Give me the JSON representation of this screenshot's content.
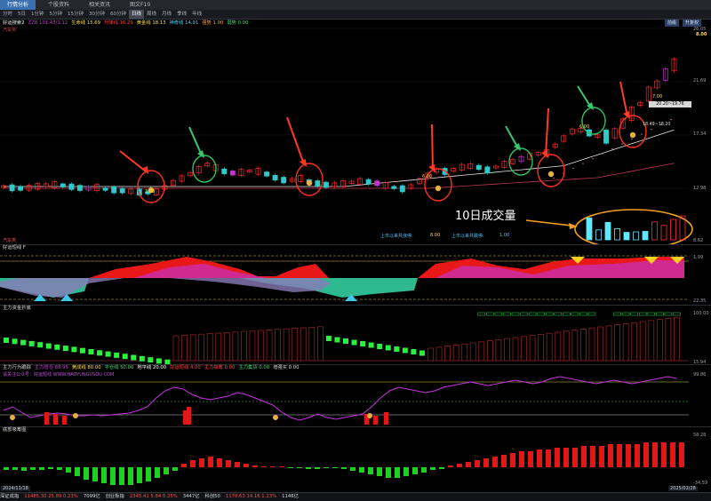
{
  "tabs": {
    "items": [
      "行情分析",
      "个股资料",
      "相关资讯",
      "图文F10"
    ],
    "active": 0
  },
  "periods": {
    "items": [
      "分时",
      "5日",
      "1分钟",
      "5分钟",
      "15分钟",
      "30分钟",
      "60分钟",
      "日线",
      "周线",
      "月线",
      "季线",
      "年线"
    ],
    "active": 7
  },
  "main_panel": {
    "header": [
      "好运搜索2",
      "ZZB 101.43/3.12",
      "生命线 15.69",
      "升降线 16.29",
      "黄金线 18.13",
      "神奇线 14.91",
      "强势 1.00",
      "弱势 0.00"
    ],
    "sublabel": "汽车类",
    "buttons": [
      "前缀",
      "升复权"
    ],
    "price_axis": [
      "26.05",
      "21.69",
      "17.34",
      "12.98",
      "8.62"
    ],
    "price_labels": [
      "8.00",
      "7.00",
      "20.20~19.76",
      "18.49~18.20",
      "6.00",
      "6.00",
      "3.00"
    ],
    "stats": [
      "上市以来共涨停:",
      "8.00",
      "上市以来共跌停:",
      "1.00"
    ],
    "annotation": "10日成交量",
    "volume_values": [
      0.88,
      0.4,
      0.7,
      0.45,
      0.3,
      0.32,
      0.34,
      0.72,
      0.58,
      0.82,
      0.96
    ]
  },
  "panel2": {
    "header": [
      "好运短线 F"
    ],
    "sublabel": "汽车类",
    "axis": [
      "1.99",
      "22.35"
    ]
  },
  "panel3": {
    "header": [
      "主力资金抄底"
    ],
    "axis": [
      "100.00",
      "15.94"
    ]
  },
  "panel4": {
    "header": [
      "主力行为跟踪",
      "主力增仓 88.95",
      "黄成线 80.00",
      "平仓线 50.00",
      "地平线 20.00",
      "好运短线 4.00",
      "主力吸筹 0.00",
      "主力集货 0.00",
      "增强买 0.00"
    ],
    "url": "请关注公众号：好运短线 WWW.HAOYUNGUSOU.COM",
    "axis": [
      "99.86"
    ]
  },
  "panel5": {
    "header": [
      "底部吸筹图"
    ],
    "axis": [
      "58.28",
      "-34.59"
    ]
  },
  "dates": [
    "2024/11/18",
    "2025/02/28"
  ],
  "status": [
    "深证成指",
    "11485.30  25.89  0.23%",
    "7099亿",
    "创业板指",
    "2345.41  5.84  0.25%",
    "3447亿",
    "科创50",
    "1170.63  14.16  1.23%",
    "1146亿"
  ],
  "colors": {
    "up": "#ff2a2a",
    "down": "#2ec9c9",
    "buy_green": "#34d058",
    "ma_white": "#e6e6e6",
    "ma_red": "#c0364d",
    "purple": "#c832d0",
    "yellow": "#e8c000",
    "orange_ann": "#f0a020"
  }
}
